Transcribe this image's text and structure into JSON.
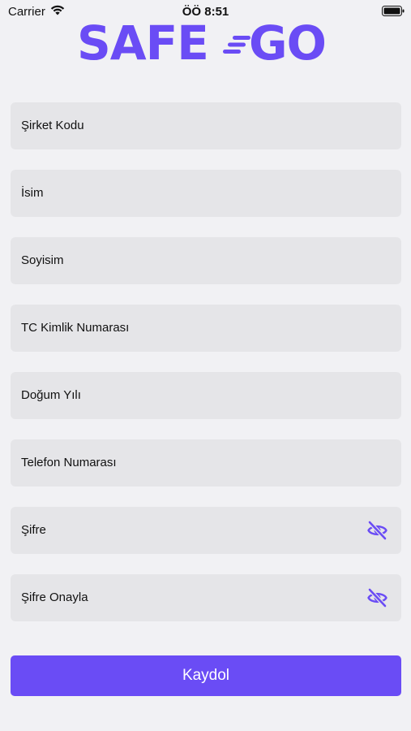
{
  "status_bar": {
    "carrier": "Carrier",
    "time": "ÖÖ 8:51"
  },
  "logo": {
    "part1": "SAFE",
    "part2": "GO",
    "color": "#6a4cf5"
  },
  "form": {
    "fields": [
      {
        "label": "Şirket Kodu"
      },
      {
        "label": "İsim"
      },
      {
        "label": "Soyisim"
      },
      {
        "label": "TC Kimlik Numarası"
      },
      {
        "label": "Doğum Yılı"
      },
      {
        "label": "Telefon Numarası"
      },
      {
        "label": "Şifre",
        "icon": "eye-off-icon"
      },
      {
        "label": "Şifre Onayla",
        "icon": "eye-off-icon"
      }
    ],
    "submit_label": "Kaydol"
  },
  "colors": {
    "accent": "#6a4cf5",
    "background": "#f1f1f4",
    "field_background": "#e5e5e8"
  }
}
